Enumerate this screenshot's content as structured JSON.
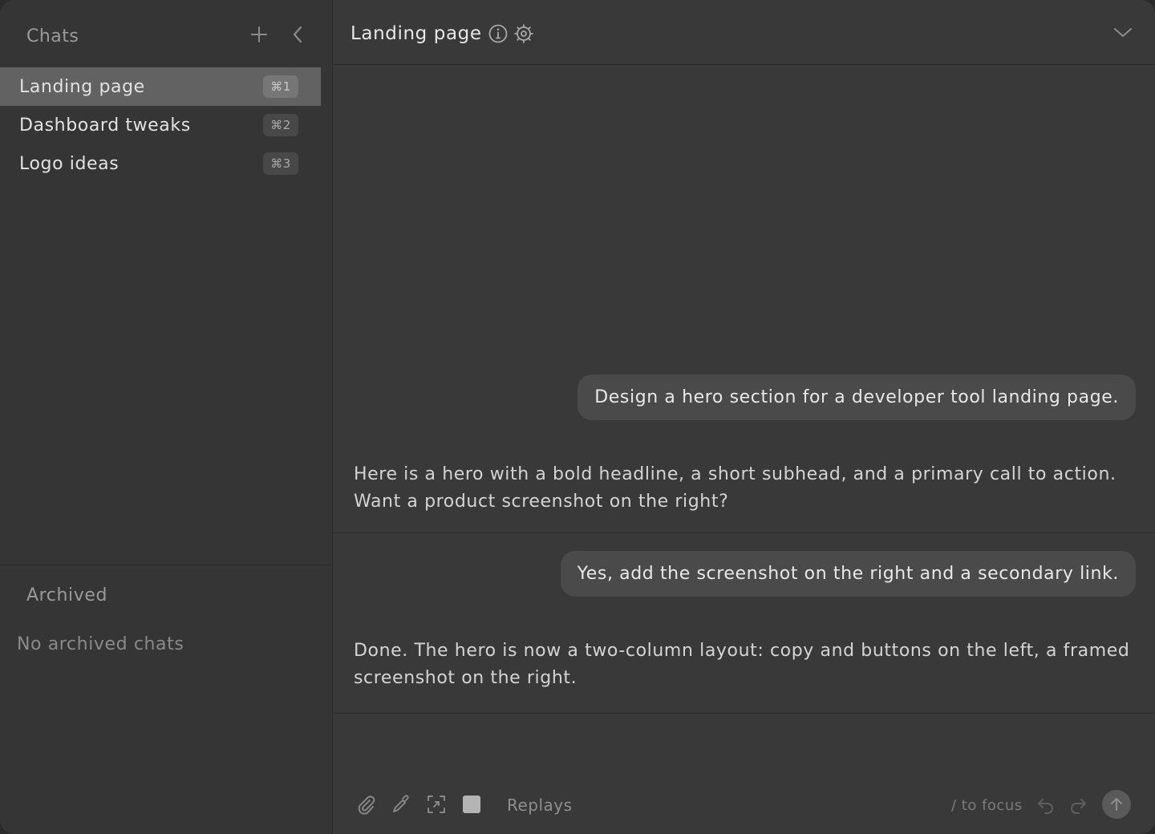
{
  "sidebar": {
    "title": "Chats",
    "chats": [
      {
        "label": "Landing page",
        "shortcut": "⌘1",
        "active": true
      },
      {
        "label": "Dashboard tweaks",
        "shortcut": "⌘2",
        "active": false
      },
      {
        "label": "Logo ideas",
        "shortcut": "⌘3",
        "active": false
      }
    ],
    "archived_title": "Archived",
    "archived_empty": "No archived chats"
  },
  "header": {
    "title": "Landing page"
  },
  "messages": [
    {
      "role": "user",
      "text": "Design a hero section for a developer tool landing page."
    },
    {
      "role": "assistant",
      "text": "Here is a hero with a bold headline, a short subhead, and a primary call to action. Want a product screenshot on the right?"
    },
    {
      "role": "user",
      "text": "Yes, add the screenshot on the right and a secondary link."
    },
    {
      "role": "assistant",
      "text": "Done. The hero is now a two-column layout: copy and buttons on the left, a framed screenshot on the right."
    }
  ],
  "composer": {
    "replays_label": "Replays",
    "focus_hint": "/ to focus"
  },
  "icons": {
    "new_chat": "plus-icon",
    "collapse": "chevron-left-icon",
    "info": "info-icon",
    "settings": "gear-icon",
    "expand": "chevron-down-icon",
    "attach": "paperclip-icon",
    "pick": "eyedropper-icon",
    "capture": "screen-capture-icon",
    "stop": "stop-square-icon",
    "undo": "undo-icon",
    "redo": "redo-icon",
    "send": "arrow-up-icon"
  },
  "colors": {
    "active_item": "#626262",
    "bubble": "#4a4a4a",
    "background": "#393939"
  }
}
